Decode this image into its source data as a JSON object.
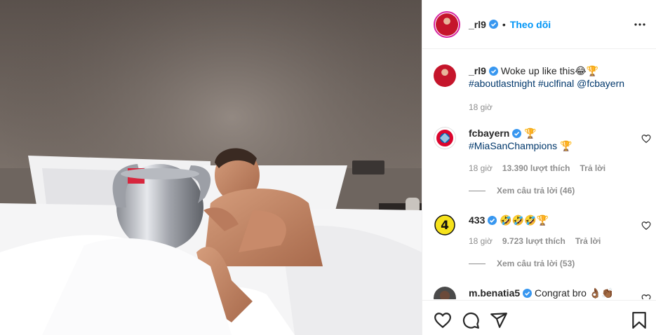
{
  "post": {
    "author": "_rl9",
    "separator": "•",
    "follow_label": "Theo dõi",
    "caption_text": "Woke up like this😂🏆",
    "caption_tags": "#aboutlastnight #uclfinal @fcbayern",
    "caption_time": "18 giờ"
  },
  "comments": [
    {
      "user": "fcbayern",
      "text_after_badge": "🏆",
      "text_line2": "#MiaSanChampions",
      "text_line2_emoji": "🏆",
      "time": "18 giờ",
      "likes": "13.390 lượt thích",
      "reply_label": "Trả lời",
      "view_replies": "Xem câu trả lời (46)"
    },
    {
      "user": "433",
      "text_after_badge": "🤣🤣🤣🏆",
      "time": "18 giờ",
      "likes": "9.723 lượt thích",
      "reply_label": "Trả lời",
      "view_replies": "Xem câu trả lời (53)"
    },
    {
      "user": "m.benatia5",
      "text_after_badge": "Congrat bro 👌🏾👏🏾"
    }
  ],
  "colors": {
    "link": "#0095f6",
    "tag": "#00376b",
    "muted": "#8e8e8e",
    "verified": "#3897f0"
  },
  "icons": [
    "more-options-icon",
    "verified-badge-icon",
    "heart-icon",
    "comment-icon",
    "share-icon",
    "bookmark-icon"
  ]
}
